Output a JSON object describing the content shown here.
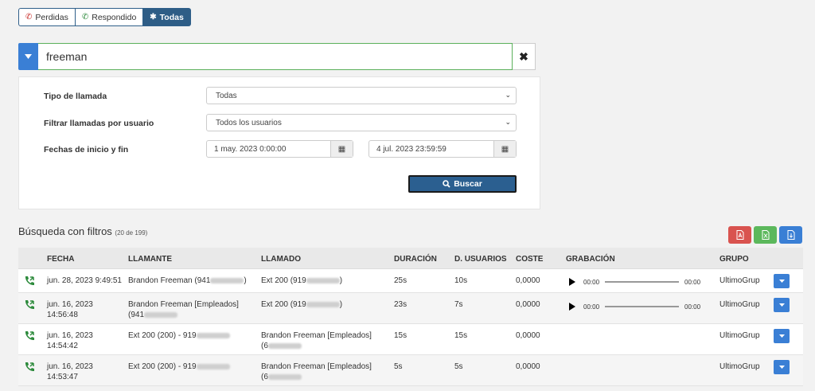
{
  "tabs": [
    {
      "label": "Perdidas",
      "icon": "phone-icon"
    },
    {
      "label": "Respondido",
      "icon": "phone-icon"
    },
    {
      "label": "Todas",
      "icon": "asterisk-icon"
    }
  ],
  "search": {
    "value": "freeman"
  },
  "filters": {
    "tipo_label": "Tipo de llamada",
    "tipo_value": "Todas",
    "usuario_label": "Filtrar llamadas por usuario",
    "usuario_value": "Todos los usuarios",
    "fechas_label": "Fechas de inicio y fin",
    "fecha_inicio": "1 may. 2023 0:00:00",
    "fecha_fin": "4 jul. 2023 23:59:59",
    "buscar_label": "Buscar"
  },
  "results": {
    "title": "Búsqueda con filtros",
    "count": "(20 de 199)"
  },
  "table": {
    "headers": [
      "FECHA",
      "LLAMANTE",
      "LLAMADO",
      "DURACIÓN",
      "D. USUARIOS",
      "COSTE",
      "GRABACIÓN",
      "GRUPO"
    ],
    "rows": [
      {
        "fecha1": "jun. 28, 2023 9:49:51",
        "fecha2": "",
        "llamante1": "Brandon Freeman (941",
        "llamante_tail": ")",
        "llamante2": "",
        "llamado1": "Ext 200 (919",
        "llamado_tail": ")",
        "llamado2": "",
        "duracion": "25s",
        "d_usuarios": "10s",
        "coste": "0,0000",
        "t_start": "00:00",
        "t_end": "00:00",
        "grupo": "UltimoGrup"
      },
      {
        "fecha1": "jun. 16, 2023",
        "fecha2": "14:56:48",
        "llamante1": "Brandon Freeman [Empleados]",
        "llamante_tail": "",
        "llamante2": "(941",
        "llamado1": "Ext 200 (919",
        "llamado_tail": ")",
        "llamado2": "",
        "duracion": "23s",
        "d_usuarios": "7s",
        "coste": "0,0000",
        "t_start": "00:00",
        "t_end": "00:00",
        "grupo": "UltimoGrup"
      },
      {
        "fecha1": "jun. 16, 2023",
        "fecha2": "14:54:42",
        "llamante1": "Ext 200 (200) - 919",
        "llamante_tail": "",
        "llamante2": "",
        "llamado1": "Brandon Freeman [Empleados]",
        "llamado_tail": "",
        "llamado2": "(6",
        "duracion": "15s",
        "d_usuarios": "15s",
        "coste": "0,0000",
        "grupo": "UltimoGrup"
      },
      {
        "fecha1": "jun. 16, 2023",
        "fecha2": "14:53:47",
        "llamante1": "Ext 200 (200) - 919",
        "llamante_tail": "",
        "llamante2": "",
        "llamado1": "Brandon Freeman [Empleados]",
        "llamado_tail": "",
        "llamado2": "(6",
        "duracion": "5s",
        "d_usuarios": "5s",
        "coste": "0,0000",
        "grupo": "UltimoGrup"
      }
    ]
  },
  "colors": {
    "primary": "#2e5d86",
    "accent": "#3a7fd5",
    "pdf": "#d9534f",
    "excel": "#5cb85c",
    "answered": "#2e8b3d",
    "missed": "#c9302c"
  }
}
